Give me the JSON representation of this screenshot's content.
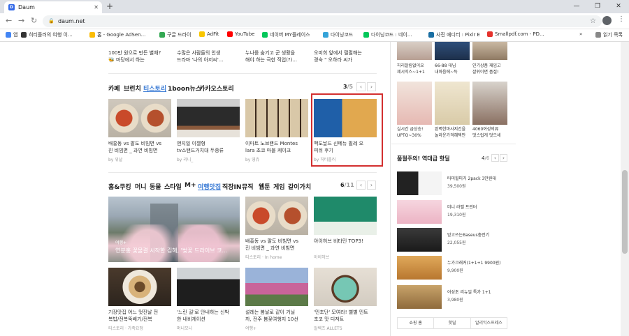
{
  "browser": {
    "tab_title": "Daum",
    "new_tab": "+",
    "url": "daum.net",
    "win": [
      "—",
      "❐",
      "✕"
    ]
  },
  "bookmarks": [
    {
      "label": "앱",
      "color": "#4285f4"
    },
    {
      "label": "히티플러의 여행 이...",
      "color": "#333333"
    },
    {
      "label": "홈 - Google AdSen...",
      "color": "#fbbc05"
    },
    {
      "label": "구글 드라이",
      "color": "#34a853"
    },
    {
      "label": "AdFit",
      "color": "#f9c600"
    },
    {
      "label": "YouTube",
      "color": "#ff0000"
    },
    {
      "label": "네이버 MY플레이스",
      "color": "#03c75a"
    },
    {
      "label": "다이닝코드",
      "color": "#35a3d8"
    },
    {
      "label": "다이닝코드 : 네이...",
      "color": "#03c75a"
    },
    {
      "label": "사진 에디터 : Pixlr E",
      "color": "#1a6fa3"
    },
    {
      "label": "Smallpdf.com - PD...",
      "color": "#e5322d"
    },
    {
      "label": "»",
      "color": "#ffffff"
    },
    {
      "label": "읽기 목록",
      "color": "#888888"
    }
  ],
  "top_row": [
    {
      "line1": "100만 원으로 만든 별채?",
      "line2": "🐝 마당에서 하는"
    },
    {
      "line1": "수많은 사람들의 인생",
      "line2": "드라마 '나의 아저씨'..."
    },
    {
      "line1": "누나를 숨기고 군 생활을",
      "line2": "해야 하는 극한 직업(?)..."
    },
    {
      "line1": "오미희 앞에서 펄펄해는",
      "line2": "경숙 \" 오하라 씨가"
    }
  ],
  "section1": {
    "tabs": [
      "카페",
      "브런치",
      "티스토리",
      "1boon뉴스",
      "카카오스토리"
    ],
    "active_tab": "티스토리",
    "page": "3",
    "total": "5",
    "items": [
      {
        "line1": "배홍동 vs 팔도 비빔면 vs",
        "line2": "진 비빔면 _ 과연 비빔면",
        "source": "by 위날"
      },
      {
        "line1": "앤지일 이젤형",
        "line2": "tv스탠드거치대 두종류",
        "source": "by 리니_"
      },
      {
        "line1": "이마트 노브랜드 Montes",
        "line2": "lara 초코 마블 케이크",
        "source": "by 영쥬"
      },
      {
        "line1": "맥도날드 신메뉴 필레 오",
        "line2": "피쉬 후기",
        "source": "by 히티플러"
      }
    ]
  },
  "section2": {
    "tabs": [
      "홈&쿠킹",
      "머니",
      "동물",
      "스타일",
      "M+",
      "여행맛집",
      "직장IN",
      "뮤직",
      "웹툰",
      "게임",
      "같이가치"
    ],
    "active_tab": "여행맛집",
    "page": "6",
    "total": "11",
    "hero": {
      "tag": "여행+",
      "title": "연분홍 꽃물결 시작한 김해, '벚꽃 드라이브 코..."
    },
    "items": [
      {
        "line1": "배홍동 vs 팔도 비빔면 vs",
        "line2": "진 비빔면 _ 과연 비빔면",
        "source": "티스토리 · In home"
      },
      {
        "line1": "아이허브 비타민 TOP3!",
        "line2": "",
        "source": "아이허브"
      },
      {
        "line1": "기장맛집 어느 멋진날 전",
        "line2": "복밥/전복뚝배기/전복",
        "source": "티스토리 · 가족요정"
      },
      {
        "line1": "'느린 길'로 안내하는 신박",
        "line2": "한 내비게이션",
        "source": "머니모니"
      },
      {
        "line1": "설레는 봄날로 같이 거닐",
        "line2": "까, 전주 봄꽃여행지 10선",
        "source": "여행+"
      },
      {
        "line1": "'민초단' 모여라! 별별 민트",
        "line2": "초코 맛 디저트",
        "source": "알렉즈 ALLETS"
      }
    ]
  },
  "right": {
    "ads_top": [
      {
        "line1": "허리잘림없이요",
        "line2": "제시믹스~1+1"
      },
      {
        "line1": "66-88 대님",
        "line2": "내마음에~득"
      },
      {
        "line1": "인기상품 재입고",
        "line2": "잘쉬이면 품절!"
      }
    ],
    "ads_mid": [
      {
        "line1": "실시간 급상승!",
        "line2": "UPTO~30%"
      },
      {
        "line1": "완벽한마사지건을",
        "line2": "놀라운가격혜택만"
      },
      {
        "line1": "4060여성의류",
        "line2": "멋스럽게 멋으세"
      }
    ],
    "deal_title": "품절주의! 역대급 핫딜",
    "deal_page": "4",
    "deal_total": "6",
    "products": [
      {
        "name": "타미힐피거 2pack 3만원대",
        "price": "39,500원"
      },
      {
        "name": "미니 라벨 프린터",
        "price": "19,310원"
      },
      {
        "name": "믿고쓰는Baseus충전기",
        "price": "22,055원"
      },
      {
        "name": "누가크래커(1+1+1 9900원)",
        "price": "9,900원"
      },
      {
        "name": "어성초 리뉴얼 특가 1+1",
        "price": "3,980원"
      }
    ],
    "shop_tabs": [
      "쇼핑 홈",
      "핫딜",
      "알리익스프레스"
    ]
  }
}
